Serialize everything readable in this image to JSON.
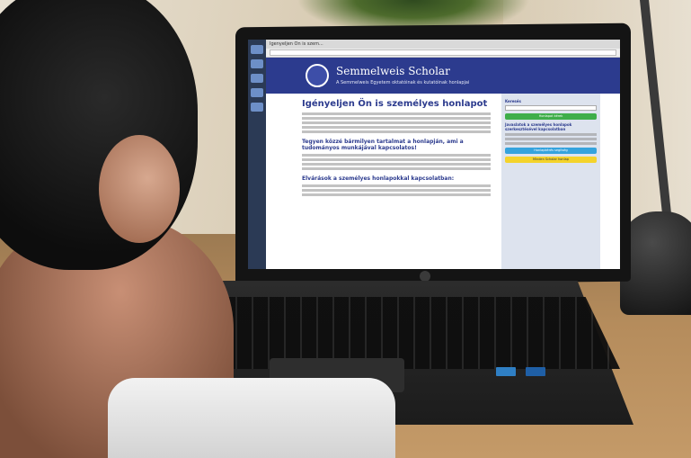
{
  "browser": {
    "tab_label": "Igenyeljen On is szem..."
  },
  "site": {
    "title": "Semmelweis Scholar",
    "subtitle": "A Semmelweis Egyetem oktatóinak és kutatóinak honlapjai"
  },
  "content": {
    "heading": "Igényeljen Ön is személyes honlapot",
    "section_2": "Tegyen közzé bármilyen tartalmat a honlapján, ami a tudományos munkájával kapcsolatos!",
    "section_3": "Elvárások a személyes honlapokkal kapcsolatban:"
  },
  "sidebar": {
    "search_label": "Keresés",
    "green_button": "Honlapot kérek",
    "info_label": "Javaslatok a személyes honlapok szerkesztésével kapcsolatban",
    "blue_button": "Honlapkérés segítség",
    "yellow_button": "Minden Scholar honlap"
  },
  "colors": {
    "header_blue": "#2c3b8e",
    "green": "#3fae4a",
    "light_blue": "#35a3dd",
    "yellow": "#f4d32b"
  }
}
